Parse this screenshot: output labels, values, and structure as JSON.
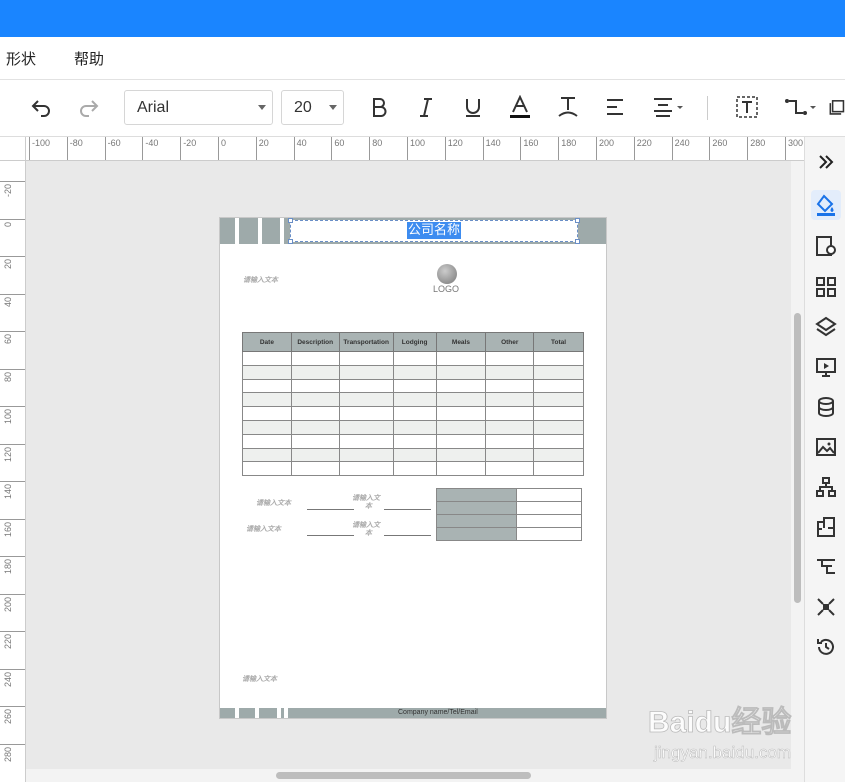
{
  "menu": {
    "items": [
      "形状",
      "帮助"
    ]
  },
  "toolbar": {
    "font_family": "Arial",
    "font_size": "20"
  },
  "ruler": {
    "h_labels": [
      "-100",
      "-80",
      "-60",
      "-40",
      "-20",
      "0",
      "20",
      "40",
      "60",
      "80",
      "100",
      "120",
      "140",
      "160",
      "180",
      "200",
      "220",
      "240",
      "260",
      "280",
      "300"
    ],
    "v_labels": [
      "-20",
      "0",
      "20",
      "40",
      "60",
      "80",
      "100",
      "120",
      "140",
      "160",
      "180",
      "200",
      "220",
      "240",
      "260",
      "280"
    ]
  },
  "document": {
    "title": "公司名称",
    "logo_text": "LOGO",
    "placeholder": "请输入文本",
    "placeholder_split_1": "请输入文",
    "placeholder_split_2": "本",
    "columns": [
      "Date",
      "Description",
      "Transportation",
      "Lodging",
      "Meals",
      "Other",
      "Total"
    ],
    "footer": "Company name/Tel/Email"
  },
  "watermark": {
    "brand": "Baidu经验",
    "url": "jingyan.baidu.com"
  }
}
